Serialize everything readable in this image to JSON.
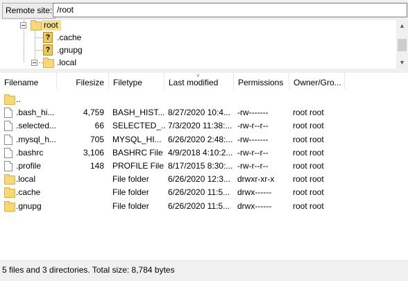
{
  "site_bar": {
    "label": "Remote site:",
    "path": "/root"
  },
  "tree": {
    "items": [
      {
        "label": "root",
        "icon": "folder-icon",
        "expanded": true,
        "selected": true
      },
      {
        "label": ".cache",
        "icon": "unknown-icon",
        "icon_glyph": "?"
      },
      {
        "label": ".gnupg",
        "icon": "unknown-icon",
        "icon_glyph": "?"
      },
      {
        "label": ".local",
        "icon": "folder-icon",
        "expanded": true
      }
    ],
    "scroll": {
      "up": "▲",
      "down": "▼"
    }
  },
  "list": {
    "columns": [
      "Filename",
      "Filesize",
      "Filetype",
      "Last modified",
      "Permissions",
      "Owner/Gro..."
    ],
    "sort_indicator": "˅",
    "rows": [
      {
        "icon": "folder-icon",
        "name": "..",
        "size": "",
        "type": "",
        "modified": "",
        "perms": "",
        "owner": ""
      },
      {
        "icon": "file-icon",
        "name": ".bash_hi...",
        "size": "4,759",
        "type": "BASH_HIST...",
        "modified": "8/27/2020 10:4...",
        "perms": "-rw-------",
        "owner": "root root"
      },
      {
        "icon": "file-icon",
        "name": ".selected...",
        "size": "66",
        "type": "SELECTED_...",
        "modified": "7/3/2020 11:38:...",
        "perms": "-rw-r--r--",
        "owner": "root root"
      },
      {
        "icon": "file-icon",
        "name": ".mysql_h...",
        "size": "705",
        "type": "MYSQL_HI...",
        "modified": "6/26/2020 2:48:...",
        "perms": "-rw-------",
        "owner": "root root"
      },
      {
        "icon": "file-icon",
        "name": ".bashrc",
        "size": "3,106",
        "type": "BASHRC File",
        "modified": "4/9/2018 4:10:2...",
        "perms": "-rw-r--r--",
        "owner": "root root"
      },
      {
        "icon": "file-icon",
        "name": ".profile",
        "size": "148",
        "type": "PROFILE File",
        "modified": "8/17/2015 8:30:...",
        "perms": "-rw-r--r--",
        "owner": "root root"
      },
      {
        "icon": "folder-icon",
        "name": ".local",
        "size": "",
        "type": "File folder",
        "modified": "6/26/2020 12:3...",
        "perms": "drwxr-xr-x",
        "owner": "root root"
      },
      {
        "icon": "folder-icon",
        "name": ".cache",
        "size": "",
        "type": "File folder",
        "modified": "6/26/2020 11:5...",
        "perms": "drwx------",
        "owner": "root root"
      },
      {
        "icon": "folder-icon",
        "name": ".gnupg",
        "size": "",
        "type": "File folder",
        "modified": "6/26/2020 11:5...",
        "perms": "drwx------",
        "owner": "root root"
      }
    ]
  },
  "status": {
    "text": "5 files and 3 directories. Total size: 8,784 bytes"
  },
  "colors": {
    "folder": "#f8d775",
    "selection": "#f6e08a",
    "chrome": "#f0f0f0"
  }
}
